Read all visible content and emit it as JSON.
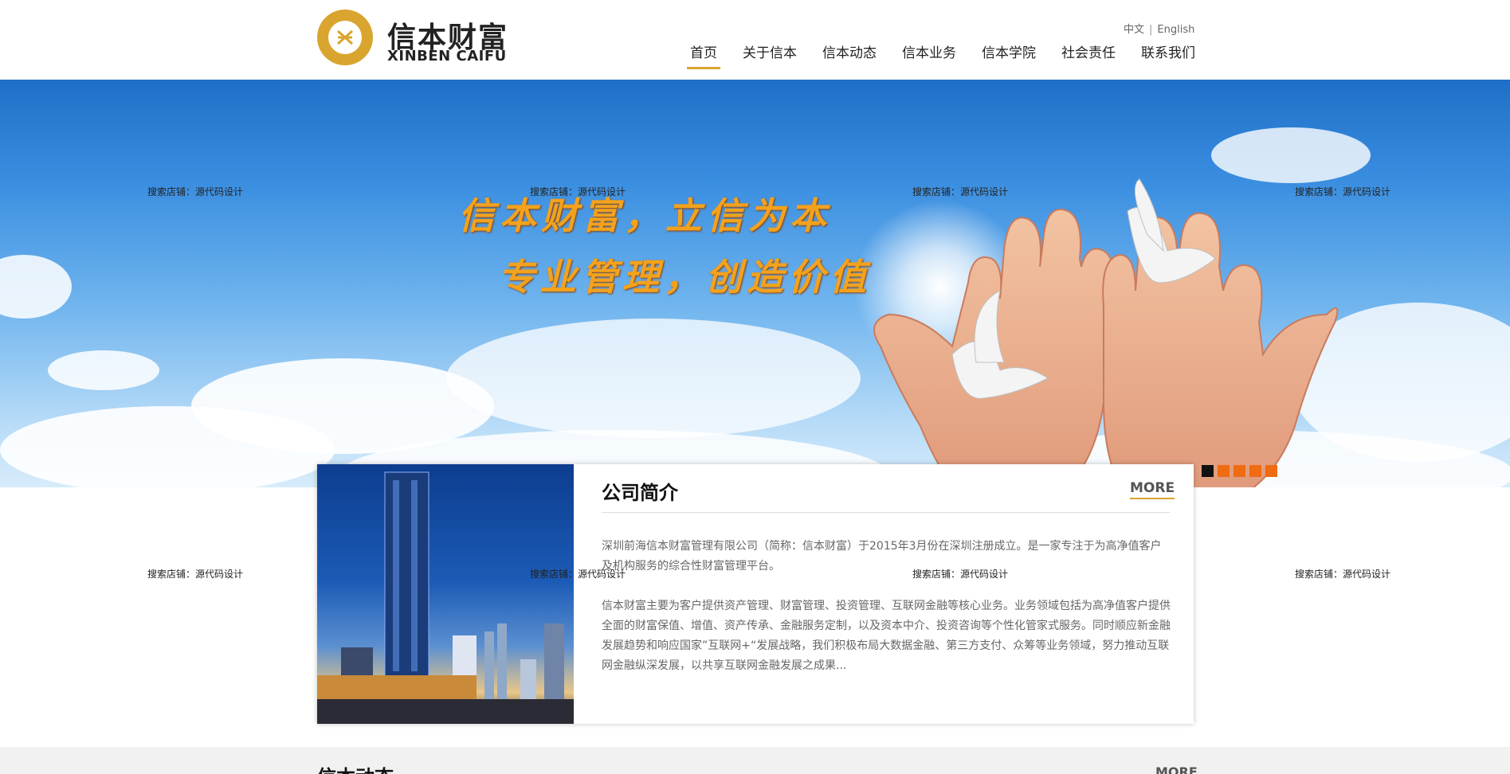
{
  "header": {
    "logo_cn": "信本财富",
    "logo_en": "XINBEN CAIFU",
    "lang": {
      "cn": "中文",
      "sep": "|",
      "en": "English"
    },
    "nav": [
      {
        "label": "首页",
        "active": true
      },
      {
        "label": "关于信本"
      },
      {
        "label": "信本动态"
      },
      {
        "label": "信本业务"
      },
      {
        "label": "信本学院"
      },
      {
        "label": "社会责任"
      },
      {
        "label": "联系我们"
      }
    ]
  },
  "banner": {
    "slogan_line1": "信本财富，立信为本",
    "slogan_line2": "专业管理，创造价值",
    "slides_count": 5,
    "active_slide": 1
  },
  "watermark": "搜索店铺：源代码设计",
  "about": {
    "title": "公司简介",
    "more": "MORE",
    "p1": "深圳前海信本财富管理有限公司（简称：信本财富）于2015年3月份在深圳注册成立。是一家专注于为高净值客户及机构服务的综合性财富管理平台。",
    "p2": "信本财富主要为客户提供资产管理、财富管理、投资管理、互联网金融等核心业务。业务领域包括为高净值客户提供全面的财富保值、增值、资产传承、金融服务定制，以及资本中介、投资咨询等个性化管家式服务。同时顺应新金融发展趋势和响应国家”互联网+“发展战略，我们积极布局大数据金融、第三方支付、众筹等业务领域，努力推动互联网金融纵深发展，以共享互联网金融发展之成果..."
  },
  "news": {
    "title": "信本动态",
    "more": "MORE"
  },
  "colors": {
    "accent_gold": "#d9a52f",
    "dot_orange": "#f06b12",
    "dot_active": "#111111"
  }
}
